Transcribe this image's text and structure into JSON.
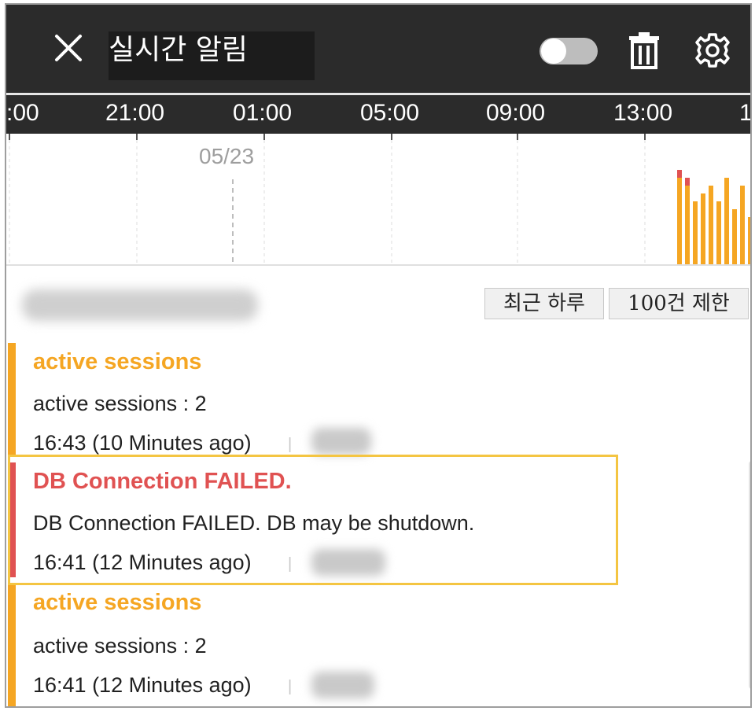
{
  "header": {
    "title": "실시간 알림",
    "close_icon": "close-icon",
    "toggle_on": false,
    "trash_icon": "trash-icon",
    "gear_icon": "gear-icon"
  },
  "timeline": {
    "ticks": [
      ":00",
      "21:00",
      "01:00",
      "05:00",
      "09:00",
      "13:00",
      "1"
    ],
    "date_label": "05/23"
  },
  "chart_data": {
    "type": "bar",
    "series": [
      {
        "name": "",
        "color": "#f5a623",
        "values": [
          11,
          10,
          8,
          9,
          10,
          8,
          11,
          7,
          10,
          6,
          9
        ]
      },
      {
        "name": "",
        "color": "#e05252",
        "values": [
          1,
          1,
          0,
          0,
          0,
          0,
          0,
          0,
          0,
          0,
          0
        ]
      }
    ]
  },
  "filters": {
    "range_label": "최근 하루",
    "limit_label": "100건 제한"
  },
  "alerts": [
    {
      "title": "active sessions",
      "message": "active sessions : 2",
      "time": "16:43 (10 Minutes ago)",
      "separator": "|",
      "level_color": "#f5a623"
    },
    {
      "title": "DB Connection FAILED.",
      "message": "DB Connection FAILED. DB may be shutdown.",
      "time": "16:41 (12 Minutes ago)",
      "separator": "|",
      "level_color": "#e05252"
    },
    {
      "title": "active sessions",
      "message": "active sessions : 2",
      "time": "16:41 (12 Minutes ago)",
      "separator": "|",
      "level_color": "#f5a623"
    }
  ],
  "colors": {
    "header_bg": "#2b2b2b",
    "warning": "#f5a623",
    "error": "#e05252",
    "highlight": "#f4c542"
  }
}
